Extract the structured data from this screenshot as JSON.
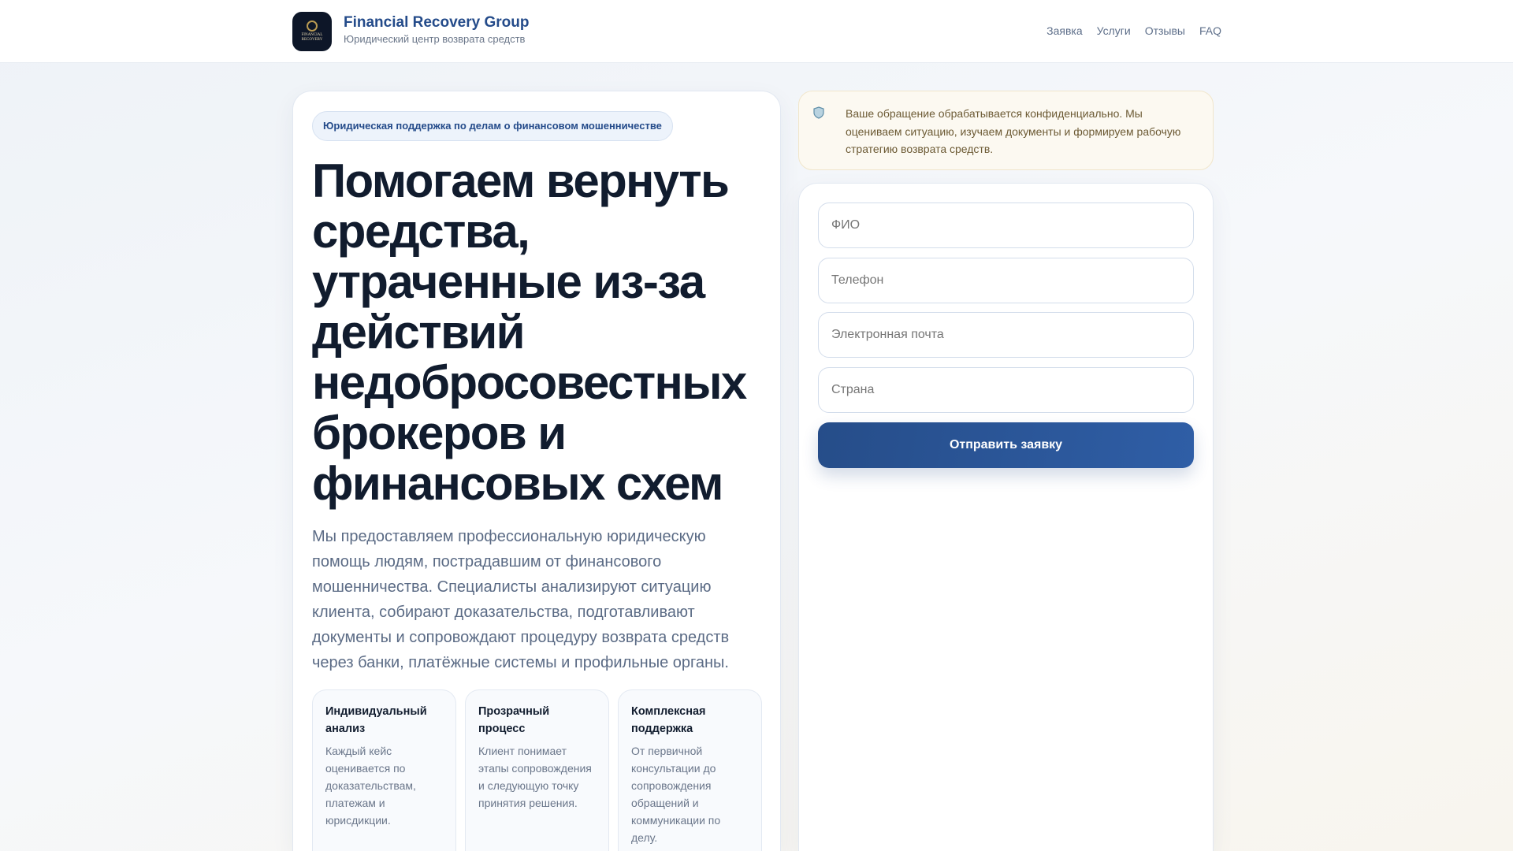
{
  "header": {
    "brand_title": "Financial Recovery Group",
    "brand_subtitle": "Юридический центр возврата средств",
    "logo_text": "FINANCIAL RECOVERY GROUP",
    "nav": [
      "Заявка",
      "Услуги",
      "Отзывы",
      "FAQ"
    ]
  },
  "hero": {
    "badge": "Юридическая поддержка по делам о финансовом мошенничестве",
    "title": "Помогаем вернуть средства, утраченные из-за действий недобросовестных брокеров и финансовых схем",
    "lead": "Мы предоставляем профессиональную юридическую помощь людям, пострадавшим от финансового мошенничества. Специалисты анализируют ситуацию клиента, собирают доказательства, подготавливают документы и сопровождают процедуру возврата средств через банки, платёжные системы и профильные органы.",
    "features": [
      {
        "title": "Индивидуальный анализ",
        "text": "Каждый кейс оценивается по доказательствам, платежам и юрисдикции."
      },
      {
        "title": "Прозрачный процесс",
        "text": "Клиент понимает этапы сопровождения и следующую точку принятия решения."
      },
      {
        "title": "Комплексная поддержка",
        "text": "От первичной консультации до сопровождения обращений и коммуникации по делу."
      }
    ]
  },
  "notice": {
    "icon": "shield-icon",
    "text": "Ваше обращение обрабатывается конфиденциально. Мы оцениваем ситуацию, изучаем документы и формируем рабочую стратегию возврата средств."
  },
  "form": {
    "name_placeholder": "ФИО",
    "phone_placeholder": "Телефон",
    "email_placeholder": "Электронная почта",
    "country_placeholder": "Страна",
    "submit_label": "Отправить заявку"
  }
}
